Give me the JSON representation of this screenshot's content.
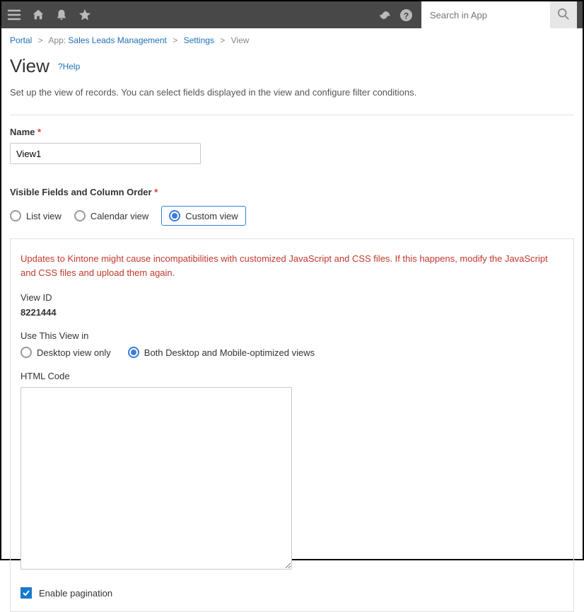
{
  "search": {
    "placeholder": "Search in App"
  },
  "breadcrumb": {
    "portal": "Portal",
    "app_prefix": "App:",
    "app_name": "Sales Leads Management",
    "settings": "Settings",
    "current": "View"
  },
  "page": {
    "title": "View",
    "help": "?Help",
    "description": "Set up the view of records. You can select fields displayed in the view and configure filter conditions."
  },
  "name_section": {
    "label": "Name",
    "value": "View1"
  },
  "fields_section": {
    "label": "Visible Fields and Column Order",
    "options": {
      "list": "List view",
      "calendar": "Calendar view",
      "custom": "Custom view"
    }
  },
  "custom_panel": {
    "warning": "Updates to Kintone might cause incompatibilities with customized JavaScript and CSS files. If this happens, modify the JavaScript and CSS files and upload them again.",
    "view_id_label": "View ID",
    "view_id_value": "8221444",
    "use_in_label": "Use This View in",
    "use_in_options": {
      "desktop": "Desktop view only",
      "both": "Both Desktop and Mobile-optimized views"
    },
    "html_code_label": "HTML Code",
    "pagination_label": "Enable pagination"
  }
}
